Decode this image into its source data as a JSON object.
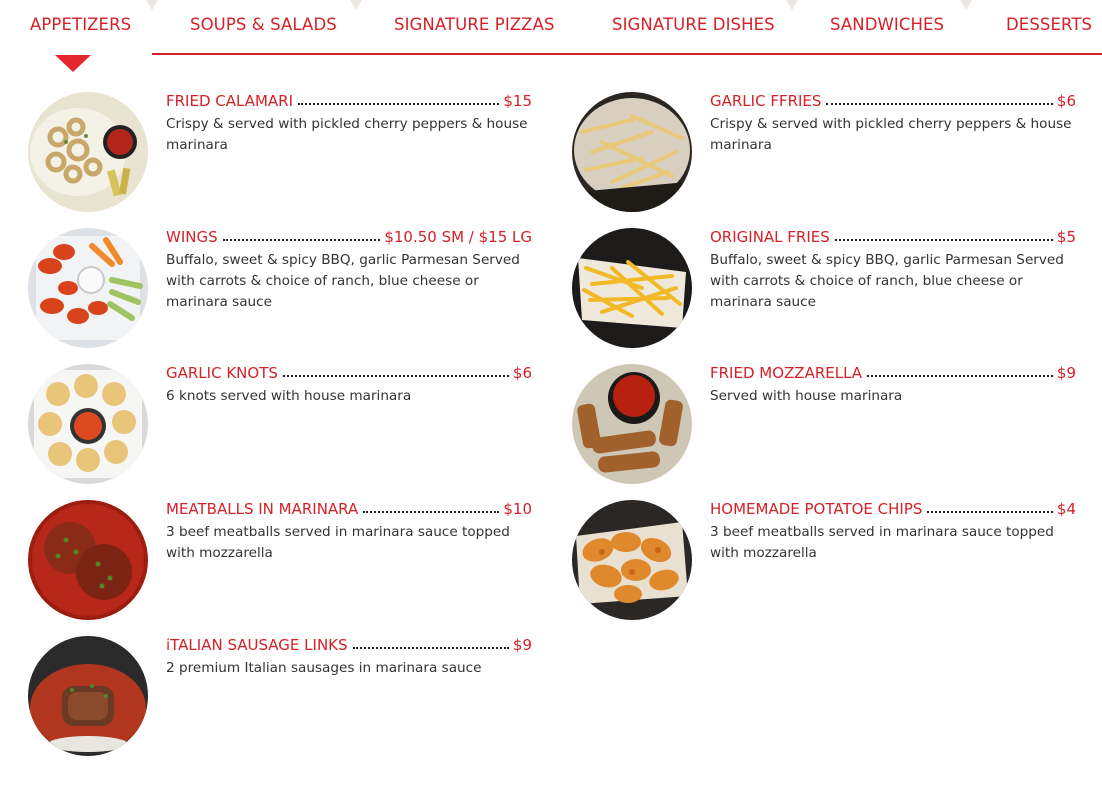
{
  "tabs": [
    {
      "label": "APPETIZERS",
      "active": true
    },
    {
      "label": "SOUPS & SALADS",
      "active": false
    },
    {
      "label": "SIGNATURE PIZZAS",
      "active": false
    },
    {
      "label": "SIGNATURE DISHES",
      "active": false
    },
    {
      "label": "SANDWICHES",
      "active": false
    },
    {
      "label": "DESSERTS",
      "active": false
    }
  ],
  "colors": {
    "accent": "#d71f26",
    "text": "#333333",
    "leader": "#222222"
  },
  "items": [
    {
      "name": "FRIED CALAMARI",
      "price": "$15",
      "desc": "Crispy & served with pickled cherry peppers & house marinara",
      "image": "fried-calamari-photo"
    },
    {
      "name": "WINGS",
      "price": "$10.50 SM / $15 LG",
      "desc": "Buffalo, sweet & spicy BBQ, garlic Parmesan Served with carrots & choice of ranch, blue cheese or marinara sauce",
      "image": "wings-photo"
    },
    {
      "name": "GARLIC KNOTS",
      "price": "$6",
      "desc": "6 knots served with house marinara",
      "image": "garlic-knots-photo"
    },
    {
      "name": "MEATBALLS IN MARINARA",
      "price": "$10",
      "desc": "3 beef meatballs served in marinara sauce topped with mozzarella",
      "image": "meatballs-photo"
    },
    {
      "name": "iTALIAN SAUSAGE LINKS",
      "price": "$9",
      "desc": "2 premium Italian sausages in marinara sauce",
      "image": "sausage-links-photo"
    },
    {
      "name": "GARLIC FFRIES",
      "price": "$6",
      "desc": "Crispy & served with pickled cherry peppers & house marinara",
      "image": "garlic-fries-photo"
    },
    {
      "name": "ORIGINAL FRIES",
      "price": "$5",
      "desc": "Buffalo, sweet & spicy BBQ, garlic Parmesan Served with carrots & choice of ranch, blue cheese or marinara sauce",
      "image": "original-fries-photo"
    },
    {
      "name": "FRIED MOZZARELLA",
      "price": "$9",
      "desc": "Served with house marinara",
      "image": "fried-mozzarella-photo"
    },
    {
      "name": "HOMEMADE POTATOE CHIPS",
      "price": "$4",
      "desc": "3 beef meatballs served in marinara sauce topped with mozzarella",
      "image": "potato-chips-photo"
    }
  ]
}
